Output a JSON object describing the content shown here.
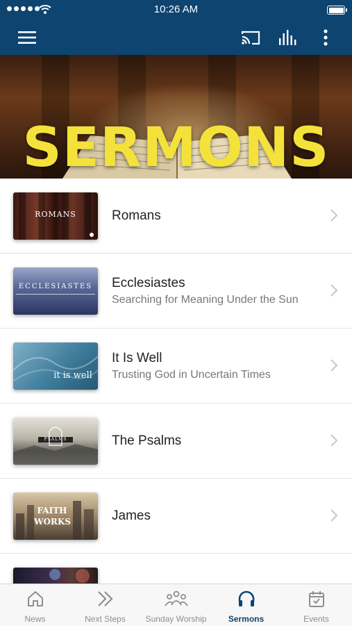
{
  "status_bar": {
    "time": "10:26 AM"
  },
  "app_bar": {
    "icons": [
      "menu-icon",
      "cast-icon",
      "equalizer-icon",
      "more-vertical-icon"
    ]
  },
  "hero": {
    "title": "SERMONS"
  },
  "sermons": [
    {
      "title": "Romans",
      "subtitle": "",
      "thumb_text": "ROMANS"
    },
    {
      "title": "Ecclesiastes",
      "subtitle": "Searching for Meaning Under the Sun",
      "thumb_text": "ECCLESIASTES"
    },
    {
      "title": "It Is Well",
      "subtitle": "Trusting God in Uncertain Times",
      "thumb_text": "it is well"
    },
    {
      "title": "The Psalms",
      "subtitle": "",
      "thumb_text": "PSALMS"
    },
    {
      "title": "James",
      "subtitle": "",
      "thumb_text": "FAITH WORKS"
    }
  ],
  "tab_bar": {
    "tabs": [
      {
        "label": "News",
        "icon": "home-icon",
        "active": false
      },
      {
        "label": "Next Steps",
        "icon": "double-chevron-icon",
        "active": false
      },
      {
        "label": "Sunday Worship",
        "icon": "people-icon",
        "active": false
      },
      {
        "label": "Sermons",
        "icon": "headphones-icon",
        "active": true
      },
      {
        "label": "Events",
        "icon": "calendar-icon",
        "active": false
      }
    ]
  },
  "colors": {
    "primary": "#0d4470",
    "hero_title": "#f4e23a"
  }
}
